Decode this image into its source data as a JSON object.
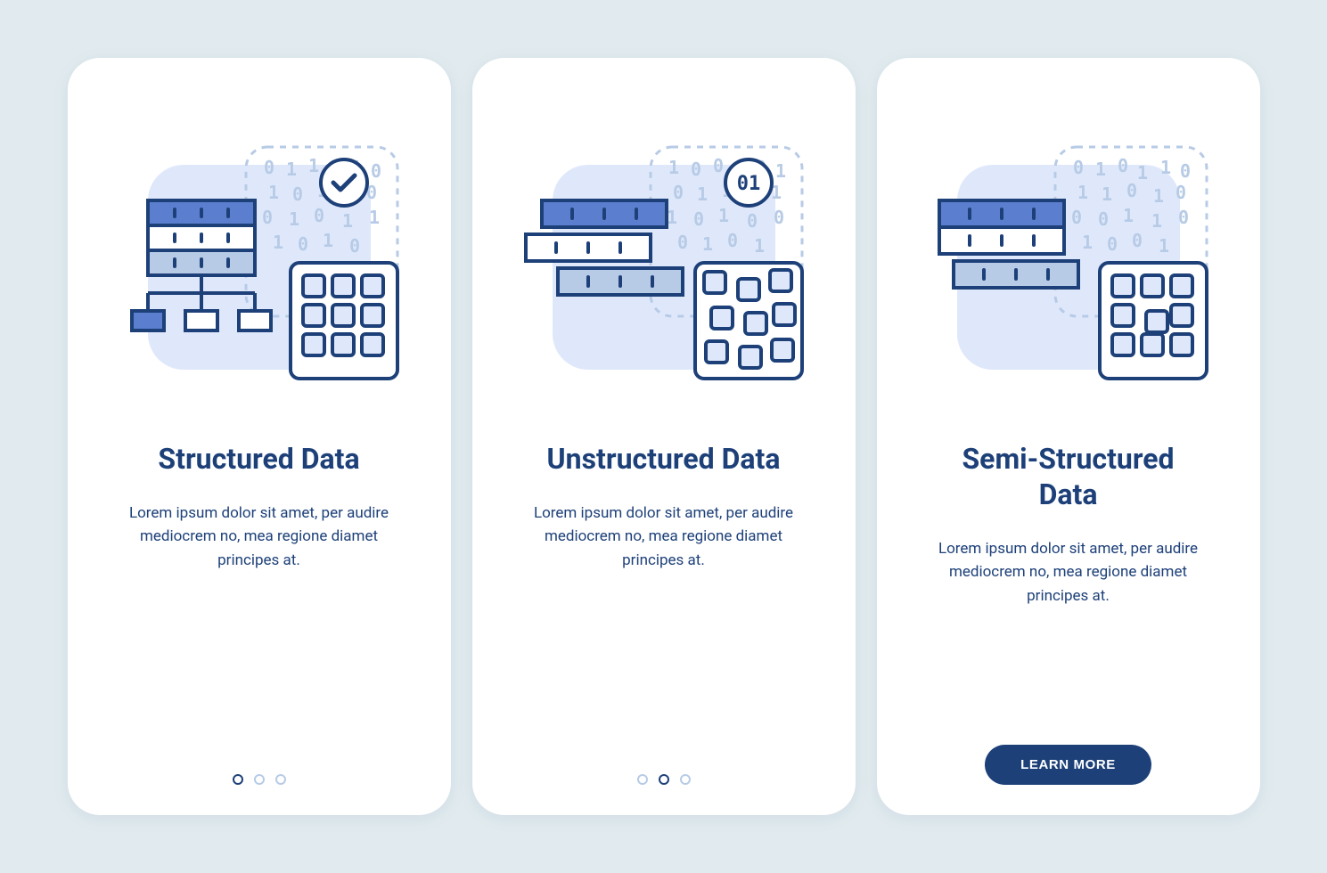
{
  "colors": {
    "background": "#e1ebef",
    "card": "#ffffff",
    "primary": "#1d4079",
    "dotInactive": "#b7cbe6",
    "illusLight": "#dfe8fb",
    "illusMid": "#b7cbe6",
    "illusAccent": "#5b7fce",
    "illusDeep": "#1d4079"
  },
  "cards": [
    {
      "id": "structured",
      "title": "Structured Data",
      "desc": "Lorem ipsum dolor sit amet, per audire mediocrem no, mea regione diamet principes at.",
      "pagination": {
        "active": 0,
        "count": 3
      },
      "cta": null,
      "icon": "structured-data-icon"
    },
    {
      "id": "unstructured",
      "title": "Unstructured Data",
      "desc": "Lorem ipsum dolor sit amet, per audire mediocrem no, mea regione diamet principes at.",
      "pagination": {
        "active": 1,
        "count": 3
      },
      "cta": null,
      "icon": "unstructured-data-icon"
    },
    {
      "id": "semi",
      "title": "Semi-Structured Data",
      "desc": "Lorem ipsum dolor sit amet, per audire mediocrem no, mea regione diamet principes at.",
      "pagination": null,
      "cta": "LEARN MORE",
      "icon": "semi-structured-data-icon"
    }
  ]
}
